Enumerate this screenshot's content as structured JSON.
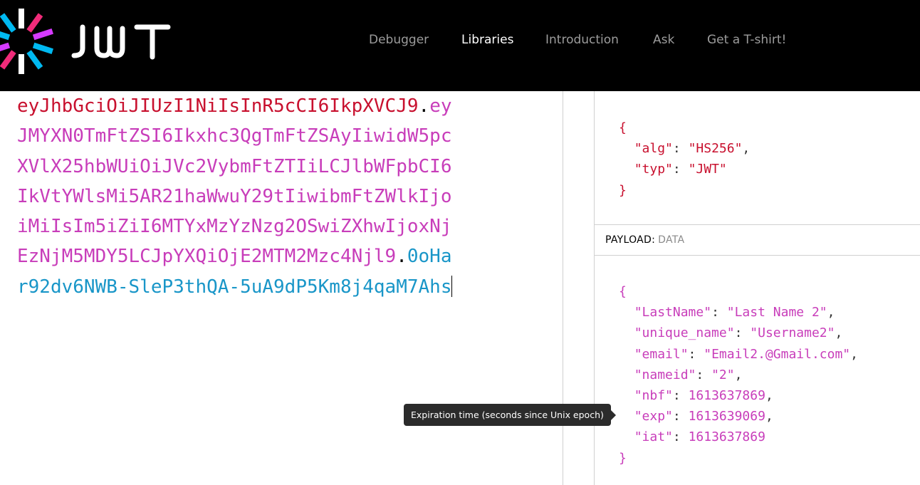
{
  "brand": {
    "name": "JWT"
  },
  "nav": {
    "items": [
      {
        "label": "Debugger",
        "active": false
      },
      {
        "label": "Libraries",
        "active": true
      },
      {
        "label": "Introduction",
        "active": false
      },
      {
        "label": "Ask",
        "active": false
      },
      {
        "label": "Get a T-shirt!",
        "active": false
      }
    ]
  },
  "encoded": {
    "lines": [
      {
        "segments": [
          {
            "text": "eyJhbGciOiJIUzI1NiIsInR5cCI6IkpXVCJ9",
            "part": "header"
          },
          {
            "text": ".",
            "part": "dot"
          },
          {
            "text": "ey",
            "part": "payload"
          }
        ]
      },
      {
        "segments": [
          {
            "text": "JMYXN0TmFtZSI6Ikxhc3QgTmFtZSAyIiwidW5pc",
            "part": "payload"
          }
        ]
      },
      {
        "segments": [
          {
            "text": "XVlX25hbWUiOiJVc2VybmFtZTIiLCJlbWFpbCI6",
            "part": "payload"
          }
        ]
      },
      {
        "segments": [
          {
            "text": "IkVtYWlsMi5AR21haWwuY29tIiwibmFtZWlkIjo",
            "part": "payload"
          }
        ]
      },
      {
        "segments": [
          {
            "text": "iMiIsIm5iZiI6MTYxMzYzNzg2OSwiZXhwIjoxNj",
            "part": "payload"
          }
        ]
      },
      {
        "segments": [
          {
            "text": "EzNjM5MDY5LCJpYXQiOjE2MTM2Mzc4Njl9",
            "part": "payload"
          },
          {
            "text": ".",
            "part": "dot"
          },
          {
            "text": "0oHa",
            "part": "sig"
          }
        ]
      },
      {
        "segments": [
          {
            "text": "r92dv6NWB-SleP3thQA-5uA9dP5Km8j4qaM7Ahs",
            "part": "sig"
          }
        ]
      }
    ]
  },
  "header_json": {
    "open": "{",
    "fields": [
      {
        "key": "\"alg\"",
        "value": "\"HS256\"",
        "comma": ","
      },
      {
        "key": "\"typ\"",
        "value": "\"JWT\"",
        "comma": ""
      }
    ],
    "close": "}"
  },
  "payload_section": {
    "title": "PAYLOAD:",
    "subtitle": "DATA"
  },
  "payload_json": {
    "open": "{",
    "fields": [
      {
        "key": "\"LastName\"",
        "value": "\"Last Name 2\"",
        "comma": ","
      },
      {
        "key": "\"unique_name\"",
        "value": "\"Username2\"",
        "comma": ","
      },
      {
        "key": "\"email\"",
        "value": "\"Email2.@Gmail.com\"",
        "comma": ","
      },
      {
        "key": "\"nameid\"",
        "value": "\"2\"",
        "comma": ","
      },
      {
        "key": "\"nbf\"",
        "value": "1613637869",
        "comma": ","
      },
      {
        "key": "\"exp\"",
        "value": "1613639069",
        "comma": ","
      },
      {
        "key": "\"iat\"",
        "value": "1613637869",
        "comma": ""
      }
    ],
    "close": "}"
  },
  "tooltip": {
    "text": "Expiration time (seconds since Unix epoch)"
  },
  "colors": {
    "header": "#c8102e",
    "payload": "#c83dba",
    "signature": "#1996c8",
    "topbar": "#000000"
  }
}
